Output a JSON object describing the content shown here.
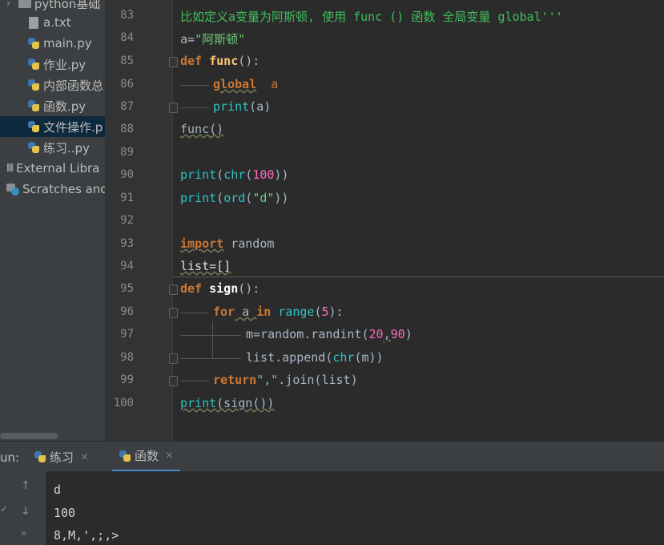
{
  "project_tree": {
    "items": [
      {
        "label": "python基础",
        "type": "folder"
      },
      {
        "label": "a.txt",
        "type": "txt"
      },
      {
        "label": "main.py",
        "type": "py"
      },
      {
        "label": "作业.py",
        "type": "py"
      },
      {
        "label": "内部函数总",
        "type": "py"
      },
      {
        "label": "函数.py",
        "type": "py"
      },
      {
        "label": "文件操作.p",
        "type": "py",
        "selected": true
      },
      {
        "label": "练习..py",
        "type": "py"
      },
      {
        "label": "External Libra",
        "type": "lib"
      },
      {
        "label": "Scratches and",
        "type": "scratch"
      }
    ]
  },
  "editor": {
    "line_numbers": [
      "83",
      "84",
      "85",
      "86",
      "87",
      "88",
      "89",
      "90",
      "91",
      "92",
      "93",
      "94",
      "95",
      "96",
      "97",
      "98",
      "99",
      "100"
    ],
    "lines": {
      "l83": "比如定义a变量为阿斯顿, 使用 func () 函数 全局变量 global'''",
      "l84_a": "a=",
      "l84_b": "\"阿斯顿\"",
      "l85_def": "def",
      "l85_fn": "func",
      "l85_rest": "():",
      "l86_kw": "global",
      "l86_var": "a",
      "l87_fn": "print",
      "l87_rest": "(a)",
      "l88": "func()",
      "l90_print": "print",
      "l90_p1": "(",
      "l90_chr": "chr",
      "l90_p2": "(",
      "l90_num": "100",
      "l90_p3": "))",
      "l91_print": "print",
      "l91_p1": "(",
      "l91_ord": "ord",
      "l91_p2": "(",
      "l91_str": "\"d\"",
      "l91_p3": "))",
      "l93_kw": "import",
      "l93_mod": " random",
      "l94": "list=[]",
      "l95_def": "def",
      "l95_fn": "sign",
      "l95_rest": "():",
      "l96_for": "for",
      "l96_a": " a ",
      "l96_in": "in",
      "l96_range": " range",
      "l96_p1": "(",
      "l96_num": "5",
      "l96_p2": "):",
      "l97_a": "m=random.randint(",
      "l97_n1": "20",
      "l97_comma": ",",
      "l97_n2": "90",
      "l97_p": ")",
      "l98_a": "list.append(",
      "l98_chr": "chr",
      "l98_b": "(m))",
      "l99_kw": "return",
      "l99_str": "\",\"",
      "l99_rest": ".join(list)",
      "l100_print": "print",
      "l100_rest": "(sign())"
    }
  },
  "run_panel": {
    "label": "un:",
    "tabs": [
      {
        "label": "练习",
        "close": "×"
      },
      {
        "label": "函数",
        "close": "×",
        "active": true
      }
    ],
    "output": [
      "d",
      "100",
      "8,M,',;,>"
    ]
  },
  "colors": {
    "keyword": "#cc7832",
    "function": "#ffc66d",
    "builtin": "#2ec4c4",
    "number": "#ff6cbb",
    "string": "#6ccb78",
    "comment": "#3fbf5b"
  }
}
